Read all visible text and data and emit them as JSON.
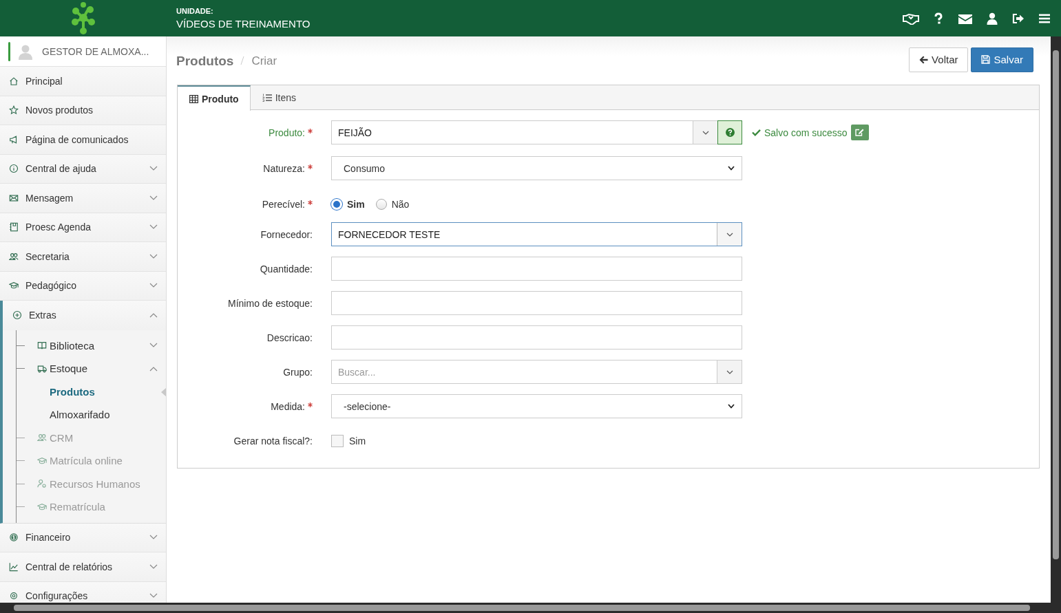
{
  "header": {
    "unit_label": "UNIDADE:",
    "unit_name": "VÍDEOS DE TREINAMENTO"
  },
  "user": {
    "name": "GESTOR DE ALMOXA..."
  },
  "sidebar": {
    "items": [
      {
        "label": "Principal"
      },
      {
        "label": "Novos produtos"
      },
      {
        "label": "Página de comunicados"
      },
      {
        "label": "Central de ajuda",
        "expanded": false
      },
      {
        "label": "Mensagem",
        "expanded": false
      },
      {
        "label": "Proesc Agenda",
        "expanded": false
      },
      {
        "label": "Secretaria",
        "expanded": false
      },
      {
        "label": "Pedagógico",
        "expanded": false
      },
      {
        "label": "Extras",
        "expanded": true,
        "children": [
          {
            "label": "Biblioteca",
            "expanded": false,
            "disabled": false
          },
          {
            "label": "Estoque",
            "expanded": true,
            "disabled": false,
            "children": [
              {
                "label": "Produtos",
                "selected": true
              },
              {
                "label": "Almoxarifado",
                "selected": false
              }
            ]
          },
          {
            "label": "CRM",
            "disabled": true
          },
          {
            "label": "Matrícula online",
            "disabled": true
          },
          {
            "label": "Recursos Humanos",
            "disabled": true
          },
          {
            "label": "Rematrícula",
            "disabled": true
          }
        ]
      },
      {
        "label": "Financeiro",
        "expanded": false
      },
      {
        "label": "Central de relatórios",
        "expanded": false
      },
      {
        "label": "Configurações",
        "expanded": false
      }
    ]
  },
  "breadcrumb": [
    "Produtos",
    "Criar"
  ],
  "actions": [
    {
      "label": "Voltar",
      "kind": "back"
    },
    {
      "label": "Salvar",
      "kind": "save"
    }
  ],
  "tabs": [
    {
      "label": "Produto",
      "selected": true
    },
    {
      "label": "Itens",
      "selected": false
    }
  ],
  "form": [
    {
      "kind": "combo",
      "label": "Produto:",
      "required": true,
      "value": "FEIJÃO",
      "valid": true,
      "message": "Salvo com sucesso"
    },
    {
      "kind": "select",
      "label": "Natureza:",
      "required": true,
      "value": "Consumo"
    },
    {
      "kind": "radio",
      "label": "Perecível:",
      "required": true,
      "options": [
        {
          "label": "Sim",
          "selected": true
        },
        {
          "label": "Não",
          "selected": false
        }
      ]
    },
    {
      "kind": "combo",
      "label": "Fornecedor:",
      "required": false,
      "value": "FORNECEDOR TESTE",
      "focused": true
    },
    {
      "kind": "text",
      "label": "Quantidade:",
      "required": false
    },
    {
      "kind": "text",
      "label": "Mínimo de estoque:",
      "required": false
    },
    {
      "kind": "text",
      "label": "Descricao:",
      "required": false
    },
    {
      "kind": "combo",
      "label": "Grupo:",
      "required": false,
      "placeholder": "Buscar..."
    },
    {
      "kind": "select",
      "label": "Medida:",
      "required": true,
      "value": "-selecione-"
    },
    {
      "kind": "checkbox",
      "label": "Gerar nota fiscal?:",
      "required": false,
      "option": "Sim",
      "checked": false
    }
  ]
}
